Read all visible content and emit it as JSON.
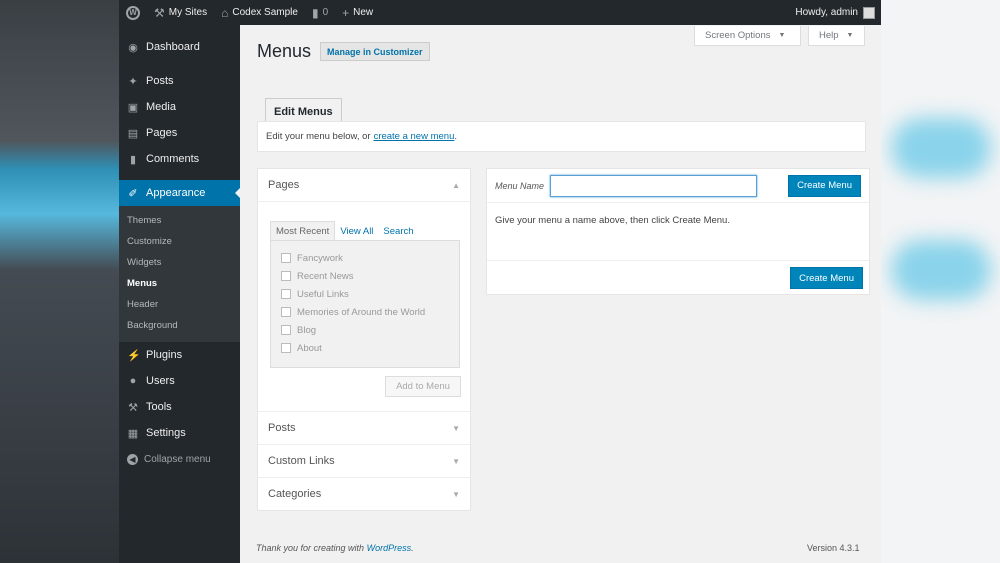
{
  "adminbar": {
    "my_sites": "My Sites",
    "site_name": "Codex Sample",
    "comments_count": "0",
    "new_label": "New",
    "howdy": "Howdy, admin"
  },
  "sidebar": {
    "items_top": [
      {
        "label": "Dashboard",
        "icon": "dashboard-icon"
      },
      {
        "label": "Posts",
        "icon": "pin-icon"
      },
      {
        "label": "Media",
        "icon": "media-icon"
      },
      {
        "label": "Pages",
        "icon": "pages-icon"
      },
      {
        "label": "Comments",
        "icon": "comments-icon"
      }
    ],
    "current": {
      "label": "Appearance",
      "icon": "paintbrush-icon"
    },
    "submenu": [
      "Themes",
      "Customize",
      "Widgets",
      "Menus",
      "Header",
      "Background"
    ],
    "items_bottom": [
      {
        "label": "Plugins",
        "icon": "plugin-icon"
      },
      {
        "label": "Users",
        "icon": "users-icon"
      },
      {
        "label": "Tools",
        "icon": "wrench-icon"
      },
      {
        "label": "Settings",
        "icon": "settings-icon"
      }
    ],
    "collapse": "Collapse menu"
  },
  "header": {
    "title": "Menus",
    "customizer_btn": "Manage in Customizer",
    "screen_options": "Screen Options",
    "help": "Help"
  },
  "tabs": {
    "edit_menus": "Edit Menus"
  },
  "notice": {
    "text": "Edit your menu below, or",
    "link": "create a new menu",
    "suffix": "."
  },
  "accordion": {
    "pages_title": "Pages",
    "tab_most_recent": "Most Recent",
    "tab_view_all": "View All",
    "tab_search": "Search",
    "pages": [
      "Fancywork",
      "Recent News",
      "Useful Links",
      "Memories of Around the World",
      "Blog",
      "About"
    ],
    "add_to_menu": "Add to Menu",
    "sections": [
      "Posts",
      "Custom Links",
      "Categories"
    ]
  },
  "editor": {
    "menu_name_label": "Menu Name",
    "menu_name_value": "",
    "create_menu": "Create Menu",
    "instructions": "Give your menu a name above, then click Create Menu."
  },
  "footer": {
    "thanks": "Thank you for creating with",
    "link": "WordPress",
    "period": ".",
    "version": "Version 4.3.1"
  },
  "colors": {
    "accent": "#0073aa",
    "admin_bar": "#23282d",
    "button": "#0085ba"
  }
}
